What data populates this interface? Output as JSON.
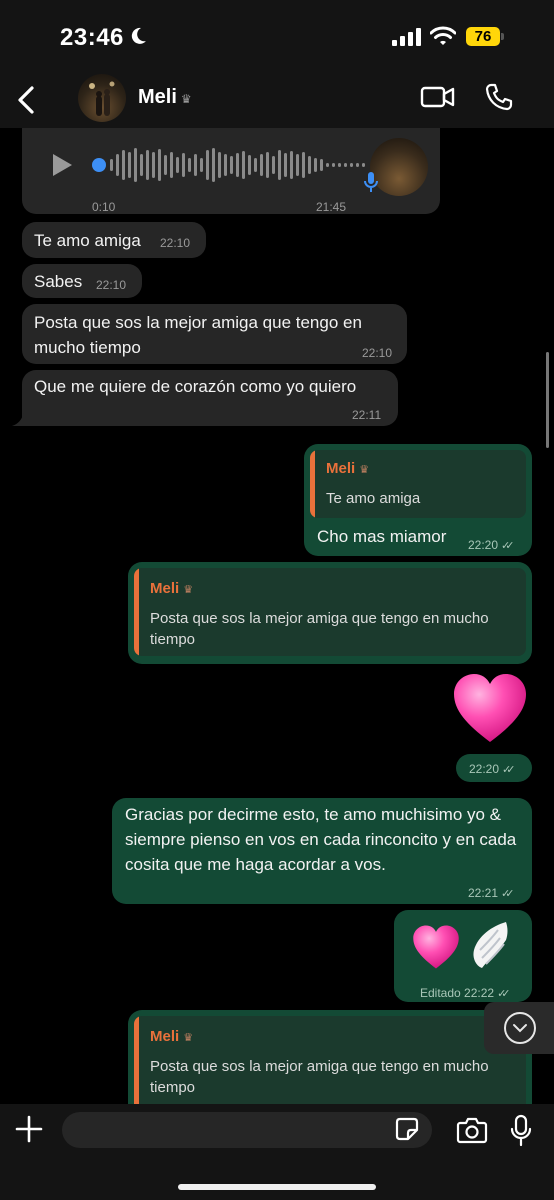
{
  "status_bar": {
    "time": "23:46",
    "battery": "76"
  },
  "header": {
    "contact_name": "Meli",
    "crown": "♛"
  },
  "voice_note": {
    "elapsed": "0:10",
    "time": "21:45"
  },
  "messages": [
    {
      "text": "Te amo amiga",
      "time": "22:10"
    },
    {
      "text": "Sabes",
      "time": "22:10"
    },
    {
      "text": "Posta que sos la mejor amiga que tengo en mucho tiempo",
      "time": "22:10"
    },
    {
      "text": "Que me quiere de corazón como yo quiero",
      "time": "22:11"
    },
    {
      "quote_name": "Meli",
      "quote_text": "Te amo amiga",
      "text": "Cho mas miamor",
      "time": "22:20"
    },
    {
      "quote_name": "Meli",
      "quote_text": "Posta que sos la mejor amiga que tengo en mucho tiempo"
    },
    {
      "emoji": "🩷",
      "time": "22:20"
    },
    {
      "text": "Gracias por decirme esto, te amo muchisimo yo & siempre pienso en vos en cada rinconcito y en cada cosita que me haga acordar a vos.",
      "time": "22:21"
    },
    {
      "emoji": "🩷 🪽",
      "edited": "Editado",
      "time": "22:22"
    },
    {
      "quote_name": "Meli",
      "quote_text": "Posta que sos la mejor amiga que tengo en mucho tiempo"
    }
  ],
  "colors": {
    "incoming": "#262626",
    "outgoing": "#134a35",
    "quote_accent": "#e9713b",
    "battery": "#ffd60a",
    "voice_dot": "#3d8ff5"
  },
  "icons": [
    "back-icon",
    "video-call-icon",
    "phone-call-icon",
    "play-icon",
    "mic-icon",
    "plus-icon",
    "sticker-icon",
    "camera-icon",
    "chevron-down-icon",
    "read-check-icon"
  ]
}
